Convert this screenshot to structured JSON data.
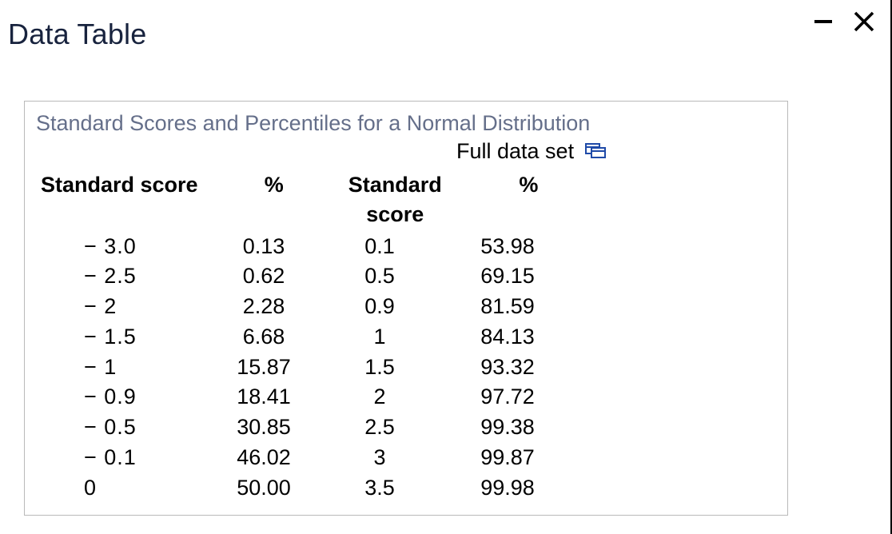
{
  "title": "Data Table",
  "panel_title": "Standard Scores and Percentiles for a Normal Distribution",
  "full_data_label": "Full data set",
  "columns": {
    "ss1": "Standard score",
    "p1": "%",
    "ss2": "Standard score",
    "p2": "%"
  },
  "chart_data": {
    "type": "table",
    "title": "Standard Scores and Percentiles for a Normal Distribution",
    "columns": [
      "Standard score",
      "%",
      "Standard score",
      "%"
    ],
    "rows": [
      {
        "ss1": "− 3.0",
        "p1": "0.13",
        "ss2": "0.1",
        "p2": "53.98"
      },
      {
        "ss1": "− 2.5",
        "p1": "0.62",
        "ss2": "0.5",
        "p2": "69.15"
      },
      {
        "ss1": "− 2",
        "p1": "2.28",
        "ss2": "0.9",
        "p2": "81.59"
      },
      {
        "ss1": "− 1.5",
        "p1": "6.68",
        "ss2": "1",
        "p2": "84.13"
      },
      {
        "ss1": "− 1",
        "p1": "15.87",
        "ss2": "1.5",
        "p2": "93.32"
      },
      {
        "ss1": "− 0.9",
        "p1": "18.41",
        "ss2": "2",
        "p2": "97.72"
      },
      {
        "ss1": "− 0.5",
        "p1": "30.85",
        "ss2": "2.5",
        "p2": "99.38"
      },
      {
        "ss1": "− 0.1",
        "p1": "46.02",
        "ss2": "3",
        "p2": "99.87"
      },
      {
        "ss1": "0",
        "p1": "50.00",
        "ss2": "3.5",
        "p2": "99.98"
      }
    ]
  }
}
